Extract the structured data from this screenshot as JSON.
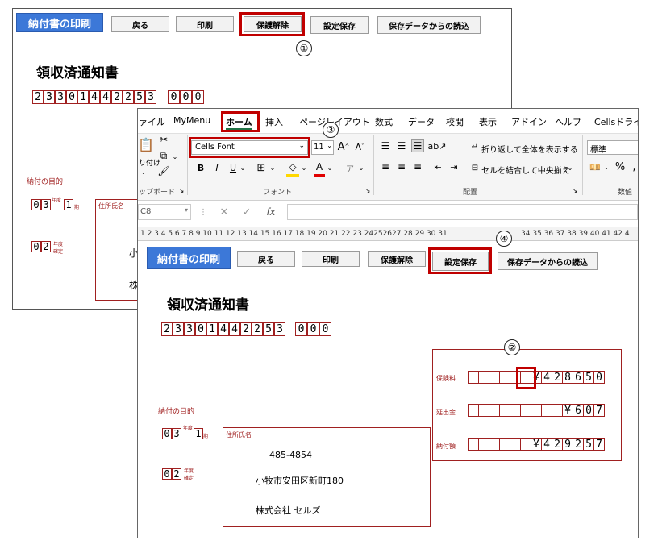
{
  "back_window": {
    "buttons": {
      "print_invoice": "納付書の印刷",
      "back": "戻る",
      "print": "印刷",
      "unprotect": "保護解除",
      "save_settings": "設定保存",
      "load_saved": "保存データからの読込"
    },
    "doc_title": "領収済通知書",
    "code_digits": [
      "2",
      "3",
      "3",
      "0",
      "1",
      "4",
      "4",
      "2",
      "2",
      "5",
      "3"
    ],
    "code_suffix": [
      "0",
      "0",
      "0"
    ],
    "purpose_label": "納付の目的",
    "purpose_digits": [
      "0",
      "3"
    ],
    "year_label": "年度",
    "period_digit": "1",
    "period_label": "期",
    "kind_digits": [
      "0",
      "2"
    ],
    "kind_label": "年度確定",
    "addr_label": "住所氏名",
    "addr_char1": "小",
    "addr_char2": "株"
  },
  "ribbon": {
    "tabs": [
      "ァイル",
      "MyMenu",
      "ホーム",
      "挿入",
      "ページレイアウト",
      "数式",
      "データ",
      "校閲",
      "表示",
      "アドイン",
      "ヘルプ",
      "Cellsドライブ"
    ],
    "font_name": "Cells Font",
    "font_size": "11",
    "wrap_text": "折り返して全体を表示する",
    "merge_center": "セルを結合して中央揃え",
    "number_format": "標準",
    "group_clipboard": "ップボード",
    "group_font": "フォント",
    "group_align": "配置",
    "group_number": "数値",
    "paste_label": "り付け",
    "name_box": "C8",
    "fx": "fx",
    "column_numbers": "1 2 3 4 5 6 7 8 9 10 11 12 13 14 15 16 17 18 19 20 21 22 23 24252627 28 29 30 31",
    "column_numbers_tail": "34 35 36 37 38 39 40 41 42 4"
  },
  "front_window": {
    "buttons": {
      "print_invoice": "納付書の印刷",
      "back": "戻る",
      "print": "印刷",
      "unprotect": "保護解除",
      "save_settings": "設定保存",
      "load_saved": "保存データからの読込"
    },
    "doc_title": "領収済通知書",
    "code_digits": [
      "2",
      "3",
      "3",
      "0",
      "1",
      "4",
      "4",
      "2",
      "2",
      "5",
      "3"
    ],
    "code_suffix": [
      "0",
      "0",
      "0"
    ],
    "purpose_label": "納付の目的",
    "purpose_digits": [
      "0",
      "3"
    ],
    "year_label": "年度",
    "period_digit": "1",
    "period_label": "期",
    "kind_digits": [
      "0",
      "2"
    ],
    "kind_label": "年度確定",
    "addr_label": "住所氏名",
    "postal": "485-4854",
    "address": "小牧市安田区新町180",
    "company": "株式会社 セルズ",
    "amounts": [
      {
        "label": "保険料",
        "digits": [
          "",
          "",
          "",
          "",
          "",
          "",
          "¥",
          "4",
          "2",
          "8",
          "6",
          "5",
          "0"
        ]
      },
      {
        "label": "延出金",
        "digits": [
          "",
          "",
          "",
          "",
          "",
          "",
          "",
          "",
          "",
          "¥",
          "6",
          "0",
          "7"
        ]
      },
      {
        "label": "納付額",
        "digits": [
          "",
          "",
          "",
          "",
          "",
          "",
          "¥",
          "4",
          "2",
          "9",
          "2",
          "5",
          "7"
        ]
      }
    ]
  },
  "callouts": [
    "①",
    "②",
    "③",
    "④"
  ],
  "colors": {
    "accent_red": "#c00000",
    "blue_button": "#3c78d8",
    "form_red": "#a02020"
  }
}
